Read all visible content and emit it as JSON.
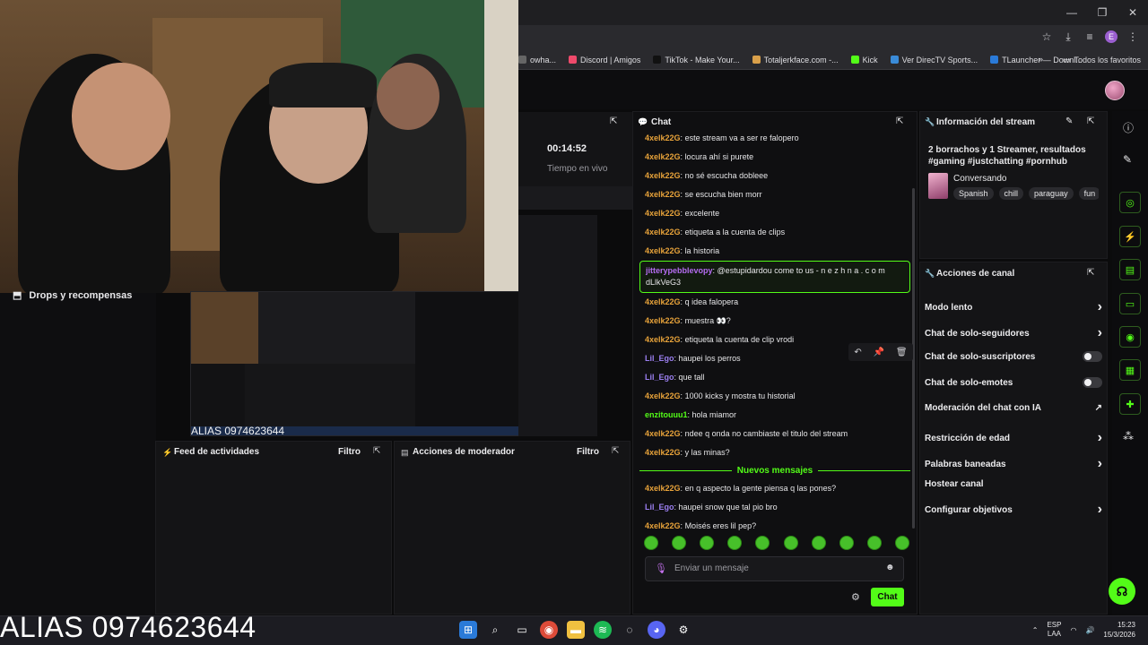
{
  "browser": {
    "bookmarks": [
      {
        "label": "owha...",
        "color": "#666"
      },
      {
        "label": "Discord | Amigos",
        "color": "#ef4a6b"
      },
      {
        "label": "TikTok - Make Your...",
        "color": "#111"
      },
      {
        "label": "Totaljerkface.com -...",
        "color": "#d9a04a"
      },
      {
        "label": "Kick",
        "color": "#53fc18"
      },
      {
        "label": "Ver DirecTV Sports...",
        "color": "#3a8bd8"
      },
      {
        "label": "TLauncher — Downl...",
        "color": "#2a7ad8"
      }
    ],
    "more_bookmarks": "»",
    "all_bookmarks": "Todos los favoritos",
    "profile_initial": "E"
  },
  "left": {
    "drops_label": "Drops y recompensas",
    "alias_small": "ALIAS 0974623644"
  },
  "session": {
    "elapsed": "00:14:52",
    "live_label": "Tiempo en vivo"
  },
  "panels": {
    "feed_title": "Feed de actividades",
    "feed_filter": "Filtro",
    "mod_title": "Acciones de moderador",
    "mod_filter": "Filtro"
  },
  "chat": {
    "title": "Chat",
    "messages": [
      {
        "user": "4xelk22G",
        "text": "este stream va a ser re falopero",
        "color": "#e8a33a"
      },
      {
        "user": "4xelk22G",
        "text": "locura ahí si purete",
        "color": "#e8a33a"
      },
      {
        "user": "4xelk22G",
        "text": "no sé escucha dobleee",
        "color": "#e8a33a"
      },
      {
        "user": "4xelk22G",
        "text": "se escucha bien morr",
        "color": "#e8a33a"
      },
      {
        "user": "4xelk22G",
        "text": "excelente",
        "color": "#e8a33a"
      },
      {
        "user": "4xelk22G",
        "text": "etiqueta a la cuenta de clips",
        "color": "#e8a33a"
      },
      {
        "user": "4xelk22G",
        "text": "la historia",
        "color": "#e8a33a"
      },
      {
        "user": "jitterypebblevopy",
        "text": "@estupidardou come to us - n e z h n a . c o m dLlkVeG3",
        "color": "#b46cf0",
        "highlight": true
      },
      {
        "user": "4xelk22G",
        "text": "q idea falopera",
        "color": "#e8a33a"
      },
      {
        "user": "4xelk22G",
        "text": "muestra 👀?",
        "color": "#e8a33a"
      },
      {
        "user": "4xelk22G",
        "text": "etiqueta la cuenta de clip vrodi",
        "color": "#e8a33a"
      },
      {
        "user": "Lil_Ego",
        "text": "haupei los perros",
        "color": "#9b7ff0"
      },
      {
        "user": "Lil_Ego",
        "text": "que tall",
        "color": "#9b7ff0"
      },
      {
        "user": "4xelk22G",
        "text": "1000 kicks y mostra tu historial",
        "color": "#e8a33a"
      },
      {
        "user": "enzitouuu1",
        "text": "hola miamor",
        "color": "#53fc18"
      },
      {
        "user": "4xelk22G",
        "text": "ndee q onda no cambiaste el titulo del stream",
        "color": "#e8a33a"
      },
      {
        "user": "4xelk22G",
        "text": "y las minas?",
        "color": "#e8a33a"
      }
    ],
    "new_messages_label": "Nuevos mensajes",
    "new_messages": [
      {
        "user": "4xelk22G",
        "text": "en q aspecto la gente piensa q las pones?",
        "color": "#e8a33a"
      },
      {
        "user": "Lil_Ego",
        "text": "haupei snow que tal pio bro",
        "color": "#9b7ff0"
      },
      {
        "user": "4xelk22G",
        "text": "Moisés eres lil pep?",
        "color": "#e8a33a"
      }
    ],
    "input_placeholder": "Enviar un mensaje",
    "send_label": "Chat"
  },
  "stream_info": {
    "title": "Información del stream",
    "stream_title": "2 borrachos y 1 Streamer, resultados #gaming #justchatting #pornhub",
    "category": "Conversando",
    "tags": [
      "Spanish",
      "chill",
      "paraguay",
      "fun"
    ]
  },
  "channel_actions": {
    "title": "Acciones de canal",
    "rows": [
      {
        "label": "Modo lento",
        "control": "chevron"
      },
      {
        "label": "Chat de solo-seguidores",
        "control": "chevron"
      },
      {
        "label": "Chat de solo-suscriptores",
        "control": "toggle"
      },
      {
        "label": "Chat de solo-emotes",
        "control": "toggle"
      },
      {
        "label": "Moderación del chat con IA",
        "control": "external"
      },
      {
        "label": "Restricción de edad",
        "control": "chevron"
      },
      {
        "label": "Palabras baneadas",
        "control": "chevron"
      },
      {
        "label": "Hostear canal",
        "control": "none"
      },
      {
        "label": "Configurar objetivos",
        "control": "chevron"
      }
    ]
  },
  "taskbar": {
    "lang_top": "ESP",
    "lang_bottom": "LAA",
    "time": "15:23",
    "date": "15/3/2026"
  },
  "overlay": {
    "alias_big": "ALIAS 0974623644"
  },
  "accent": "#53fc18"
}
